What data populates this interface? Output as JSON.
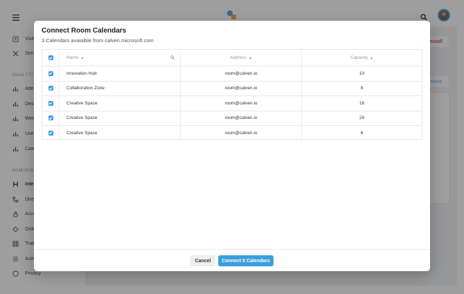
{
  "topbar": {
    "menu_icon": "menu-icon",
    "logo": "app-logo",
    "search_icon": "search-icon",
    "avatar": "user-avatar"
  },
  "sidebar": {
    "items_top": [
      {
        "label": "Visito",
        "icon": "visitor-icon"
      },
      {
        "label": "Servi",
        "icon": "services-icon"
      }
    ],
    "analytics_label": "ANALYTICS",
    "analytics_items": [
      {
        "label": "Atten",
        "icon": "bar-chart-icon"
      },
      {
        "label": "Desk",
        "icon": "bar-chart-icon"
      },
      {
        "label": "Wee",
        "icon": "bar-chart-icon"
      },
      {
        "label": "User",
        "icon": "bar-chart-icon"
      },
      {
        "label": "Cate",
        "icon": "bar-chart-icon"
      }
    ],
    "admin_label": "ADMINIST",
    "admin_items": [
      {
        "label": "Integ",
        "icon": "integrations-icon",
        "active": true
      },
      {
        "label": "Direc",
        "icon": "directory-icon"
      },
      {
        "label": "Acce",
        "icon": "access-icon"
      },
      {
        "label": "Onbo",
        "icon": "onboarding-icon"
      },
      {
        "label": "Traits",
        "icon": "traits-icon"
      },
      {
        "label": "Activ",
        "icon": "list-icon"
      },
      {
        "label": "Privacy",
        "icon": "shield-icon"
      }
    ]
  },
  "background": {
    "uninstall_label": "Uninstall",
    "actions_label": "Actions"
  },
  "modal": {
    "title": "Connect Room Calendars",
    "subtitle": "3 Calendars avaialble from calven.microsoft.com",
    "columns": {
      "name": "Name",
      "address": "Address",
      "capacity": "Capacity"
    },
    "rows": [
      {
        "name": "Innovation Hub",
        "address": "room@calven.io",
        "capacity": "10",
        "checked": true
      },
      {
        "name": "Collaboration Zone",
        "address": "room@calven.io",
        "capacity": "8",
        "checked": true
      },
      {
        "name": "Creative Space",
        "address": "room@calven.io",
        "capacity": "16",
        "checked": true
      },
      {
        "name": "Creative Space",
        "address": "room@calven.io",
        "capacity": "24",
        "checked": true
      },
      {
        "name": "Creative Space",
        "address": "room@calven.io",
        "capacity": "6",
        "checked": true
      }
    ],
    "cancel_label": "Cancel",
    "connect_label": "Connect 5 Calendars"
  },
  "colors": {
    "accent": "#3a9fdc",
    "danger": "#e0413f"
  }
}
